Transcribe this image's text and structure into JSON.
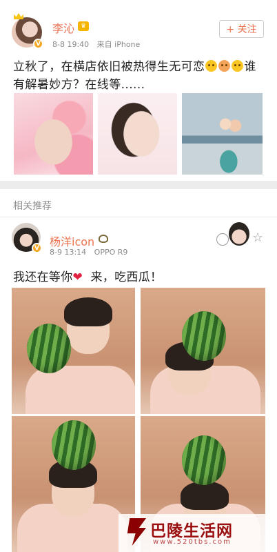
{
  "post1": {
    "username": "李沁",
    "time": "8-8 19:40",
    "source": "来自 iPhone",
    "follow_label": "+ 关注",
    "text_part1": "立秋了，在横店依旧被热得生无可恋",
    "text_part2": "谁有解暑妙方？在线等......"
  },
  "section": {
    "label": "相关推荐"
  },
  "post2": {
    "username": "杨洋icon",
    "time": "8-9 13:14",
    "source": "OPPO R9",
    "text_part1": "我还在等你",
    "heart": "❤",
    "text_part2": "来，吃西瓜！"
  },
  "watermark": {
    "text": "巴陵生活网",
    "url": "www.520tbs.com"
  },
  "colors": {
    "username": "#eb7350",
    "divider": "#ececec",
    "watermark": "#9a1010"
  }
}
